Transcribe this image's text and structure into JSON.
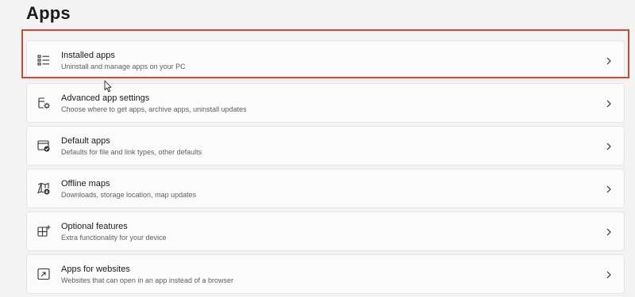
{
  "page": {
    "title": "Apps"
  },
  "items": [
    {
      "label": "Installed apps",
      "description": "Uninstall and manage apps on your PC",
      "icon": "list-icon"
    },
    {
      "label": "Advanced app settings",
      "description": "Choose where to get apps, archive apps, uninstall updates",
      "icon": "app-settings-icon"
    },
    {
      "label": "Default apps",
      "description": "Defaults for file and link types, other defaults",
      "icon": "default-apps-icon"
    },
    {
      "label": "Offline maps",
      "description": "Downloads, storage location, map updates",
      "icon": "map-icon"
    },
    {
      "label": "Optional features",
      "description": "Extra functionality for your device",
      "icon": "optional-features-icon"
    },
    {
      "label": "Apps for websites",
      "description": "Websites that can open in an app instead of a browser",
      "icon": "open-in-app-icon"
    }
  ],
  "colors": {
    "highlight": "#cc4a32",
    "background": "#f3f3f3",
    "card": "#fbfbfb"
  }
}
